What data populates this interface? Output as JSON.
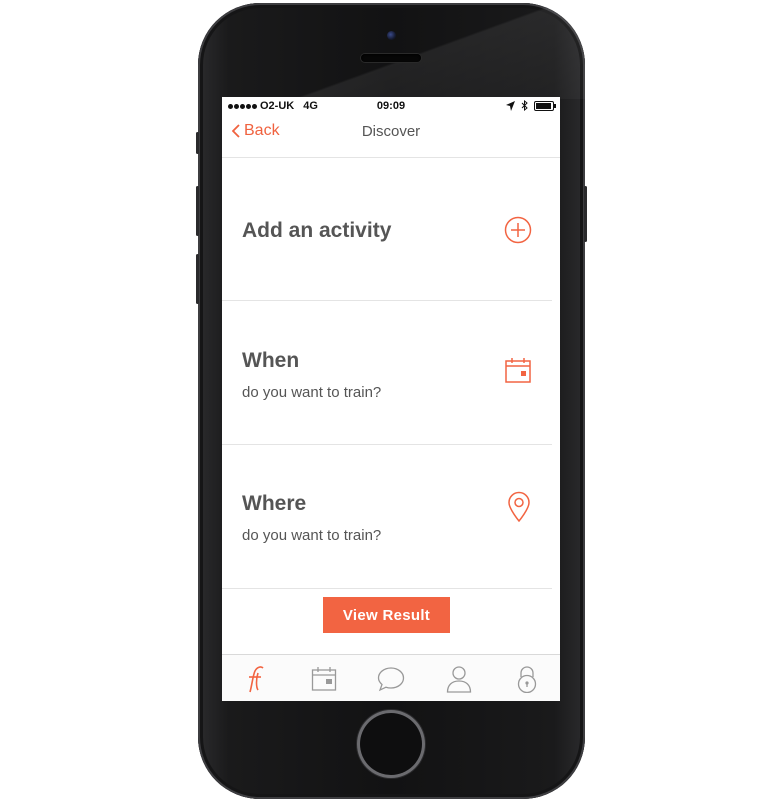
{
  "status_bar": {
    "carrier": "O2-UK",
    "network": "4G",
    "time": "09:09"
  },
  "nav": {
    "back_label": "Back",
    "title": "Discover"
  },
  "rows": [
    {
      "title": "Add an activity",
      "subtitle": "",
      "icon": "plus-circle-icon"
    },
    {
      "title": "When",
      "subtitle": "do you want to train?",
      "icon": "calendar-icon"
    },
    {
      "title": "Where",
      "subtitle": "do you want to train?",
      "icon": "location-pin-icon"
    }
  ],
  "view_result_label": "View  Result",
  "tabs": [
    {
      "name": "home",
      "icon": "app-logo-icon",
      "active": true
    },
    {
      "name": "calendar",
      "icon": "calendar-icon"
    },
    {
      "name": "messages",
      "icon": "chat-bubble-icon"
    },
    {
      "name": "profile",
      "icon": "user-icon"
    },
    {
      "name": "lock",
      "icon": "padlock-icon"
    }
  ],
  "colors": {
    "accent": "#f26442",
    "text": "#555555",
    "divider": "#e4e4e4",
    "tab_inactive": "#999999"
  }
}
